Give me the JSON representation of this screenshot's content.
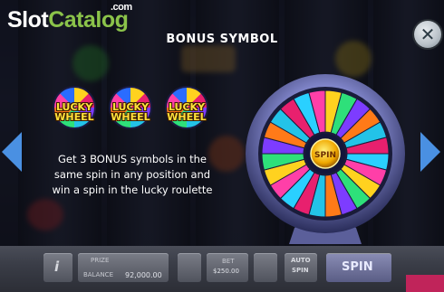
{
  "logo": {
    "part1": "Slot",
    "part2": "Catalog",
    "suffix": ".com"
  },
  "popup": {
    "title": "BONUS SYMBOL",
    "close_glyph": "✕",
    "symbol_text_line1": "LUCKY",
    "symbol_text_line2": "WHEEL",
    "description_lines": [
      "Get 3 BONUS symbols in the",
      "same spin in any position and",
      "win a spin in the lucky roulette"
    ],
    "wheel_center_label": "SPIN"
  },
  "controls": {
    "prize_label": "PRIZE",
    "balance_label": "BALANCE",
    "balance_value": "92,000.00",
    "bet_label": "BET",
    "bet_value": "$250.00",
    "auto_spin_label_1": "AUTO",
    "auto_spin_label_2": "SPIN",
    "spin_label": "SPIN",
    "info_glyph": "i"
  },
  "colors": {
    "accent_blue": "#4a90e2",
    "logo_green": "#8bc34a",
    "symbol_yellow": "#ffe23a"
  },
  "icons": [
    "close-icon",
    "arrow-left-icon",
    "arrow-right-icon",
    "info-icon"
  ]
}
